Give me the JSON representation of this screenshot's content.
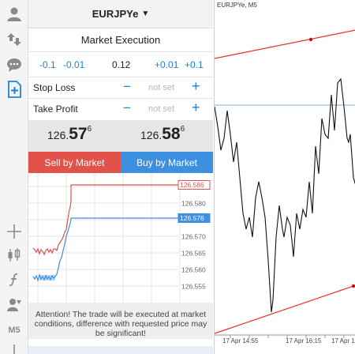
{
  "toolbar": {
    "icons": [
      "account-icon",
      "trade-icon",
      "chat-icon",
      "new-order-icon",
      "crosshair-icon",
      "candles-icon",
      "indicators-icon",
      "objects-icon"
    ],
    "timeframe": "M5"
  },
  "order": {
    "symbol": "EURJPYe",
    "execution": "Market Execution",
    "volume": {
      "steps_minus": [
        "-0.1",
        "-0.01"
      ],
      "value": "0.12",
      "steps_plus": [
        "+0.01",
        "+0.1"
      ]
    },
    "stop_loss": {
      "label": "Stop Loss",
      "minus": "−",
      "value": "not set",
      "plus": "+"
    },
    "take_profit": {
      "label": "Take Profit",
      "minus": "−",
      "value": "not set",
      "plus": "+"
    },
    "bid": {
      "small": "126.",
      "big": "57",
      "sup": "6"
    },
    "ask": {
      "small": "126.",
      "big": "58",
      "sup": "6"
    },
    "sell_label": "Sell by Market",
    "buy_label": "Buy by Market",
    "attention": "Attention! The trade will be executed at market conditions, difference with requested price may be significant!"
  },
  "tick_chart": {
    "y_ticks": [
      "126.586",
      "126.580",
      "126.575",
      "126.570",
      "126.565",
      "126.560",
      "126.555"
    ],
    "ask_label": "126.586",
    "bid_label": "126.576",
    "colors": {
      "ask": "#e0524a",
      "bid": "#3d8fe0"
    }
  },
  "chart": {
    "title": "EURJPYe, M5",
    "time_labels": [
      "17 Apr 14:55",
      "17 Apr 16:15",
      "17 Apr 1"
    ],
    "colors": {
      "trend": "#e8302a",
      "bid_line": "#8aaed6",
      "price": "#111111"
    }
  }
}
